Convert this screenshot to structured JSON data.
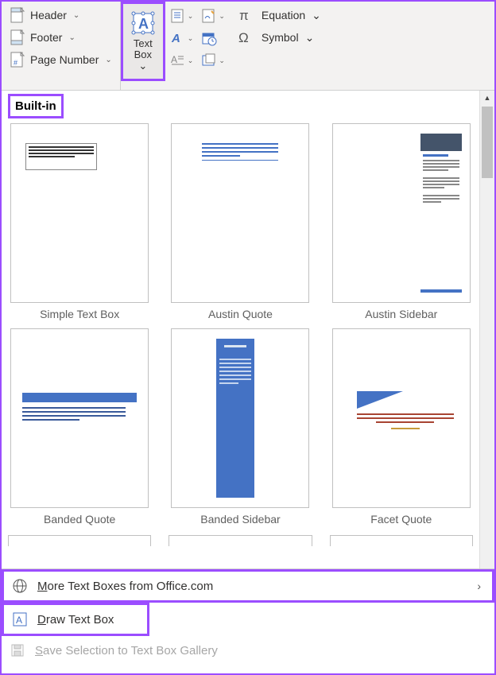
{
  "ribbon": {
    "header": "Header",
    "footer": "Footer",
    "page_number": "Page Number",
    "text_box": "Text Box",
    "equation": "Equation",
    "symbol": "Symbol"
  },
  "gallery": {
    "section": "Built-in",
    "items": [
      {
        "label": "Simple Text Box"
      },
      {
        "label": "Austin Quote"
      },
      {
        "label": "Austin Sidebar"
      },
      {
        "label": "Banded Quote"
      },
      {
        "label": "Banded Sidebar"
      },
      {
        "label": "Facet Quote"
      }
    ]
  },
  "menu": {
    "more": "More Text Boxes from Office.com",
    "draw": "Draw Text Box",
    "save": "Save Selection to Text Box Gallery"
  }
}
